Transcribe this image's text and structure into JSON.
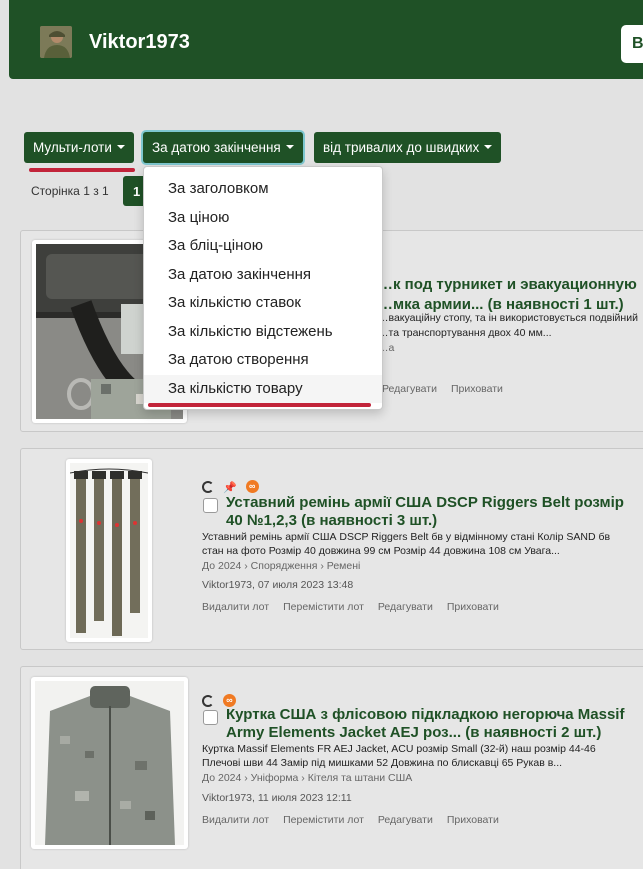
{
  "header": {
    "username": "Viktor1973",
    "button_label": "Від"
  },
  "filters": {
    "multilot": "Мульти-лоти",
    "sort_by": "За датою закінчення",
    "order": "від тривалих до швидких"
  },
  "pagination": {
    "info": "Сторінка 1 з 1",
    "current": "1"
  },
  "dropdown": {
    "items": [
      "За заголовком",
      "За ціною",
      "За бліц-ціною",
      "За датою закінчення",
      "За кількістю ставок",
      "За кількістю відстежень",
      "За датою створення",
      "За кількістю товару"
    ]
  },
  "cards": [
    {
      "title_line1": "…к под турникет и эвакуационную",
      "title_line2": "…мка армии... (в наявності 1 шт.)",
      "desc_line1": "…вакуаційну стопу, та ін використовується подвійний",
      "desc_line2": "…та транспортування двох 40 мм...",
      "category": "…а",
      "actions": [
        "Редагувати",
        "Приховати"
      ]
    },
    {
      "title_line1": "Уставний ремінь армії США DSCP Riggers Belt розмір",
      "title_line2": "40 №1,2,3 (в наявності 3 шт.)",
      "desc_line1": "Уставний ремінь армії США DSCP Riggers Belt бв у відмінному стані Колір SAND бв",
      "desc_line2": "стан на фото Розмір 40 довжина 99 см Розмір 44 довжина 108 см Увага...",
      "category": "До 2024 › Спорядження › Ремені",
      "meta": "Viktor1973, 07 июля 2023 13:48",
      "actions": [
        "Видалити лот",
        "Перемістити лот",
        "Редагувати",
        "Приховати"
      ]
    },
    {
      "title_line1": "Куртка США з флісовою підкладкою негорюча Massif",
      "title_line2": "Army Elements Jacket AEJ роз... (в наявності 2 шт.)",
      "desc_line1": "Куртка Massif Elements FR AEJ Jacket, ACU розмір Small (32-й) наш розмір 44-46",
      "desc_line2": "Плечові шви 44 Замір під мишками 52 Довжина по блискавці 65 Рукав в...",
      "category": "До 2024 › Уніформа › Кітеля та штани США",
      "meta": "Viktor1973, 11 июля 2023 12:11",
      "actions": [
        "Видалити лот",
        "Перемістити лот",
        "Редагувати",
        "Приховати"
      ]
    }
  ],
  "colors": {
    "brand_green": "#1f5126",
    "accent_red": "#c2243a",
    "focus_ring": "#7ec7cf",
    "infinity_orange": "#f07a23"
  }
}
